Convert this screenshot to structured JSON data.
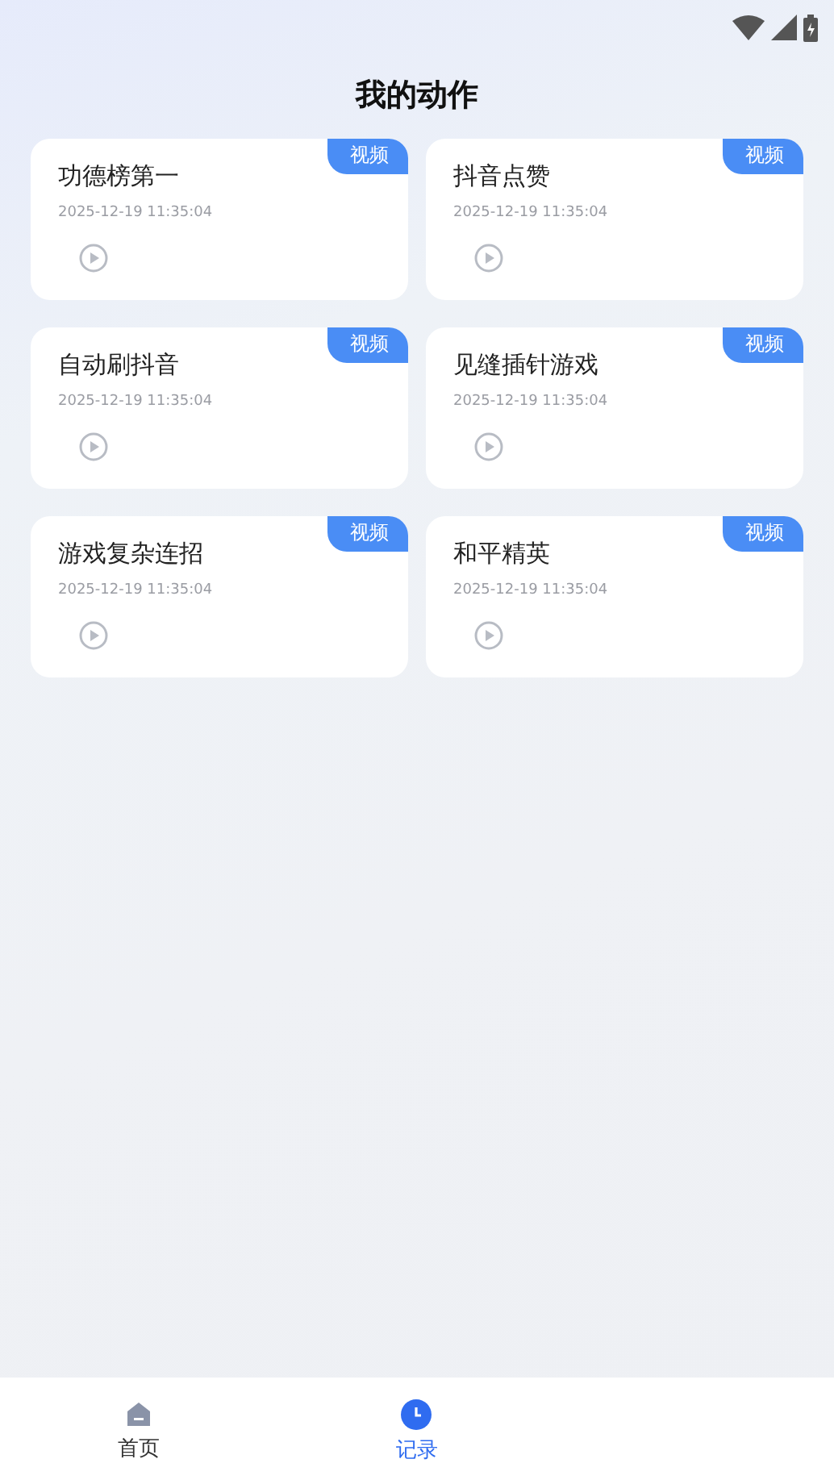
{
  "header": {
    "title": "我的动作"
  },
  "actions": [
    {
      "title": "功德榜第一",
      "date": "2025-12-19 11:35:04",
      "badge": "视频"
    },
    {
      "title": "抖音点赞",
      "date": "2025-12-19 11:35:04",
      "badge": "视频"
    },
    {
      "title": "自动刷抖音",
      "date": "2025-12-19 11:35:04",
      "badge": "视频"
    },
    {
      "title": "见缝插针游戏",
      "date": "2025-12-19 11:35:04",
      "badge": "视频"
    },
    {
      "title": "游戏复杂连招",
      "date": "2025-12-19 11:35:04",
      "badge": "视频"
    },
    {
      "title": "和平精英",
      "date": "2025-12-19 11:35:04",
      "badge": "视频"
    }
  ],
  "tab_bar": [
    {
      "kind": "home",
      "label": "首页",
      "selected": false
    },
    {
      "kind": "record",
      "label": "记录",
      "selected": true
    }
  ]
}
